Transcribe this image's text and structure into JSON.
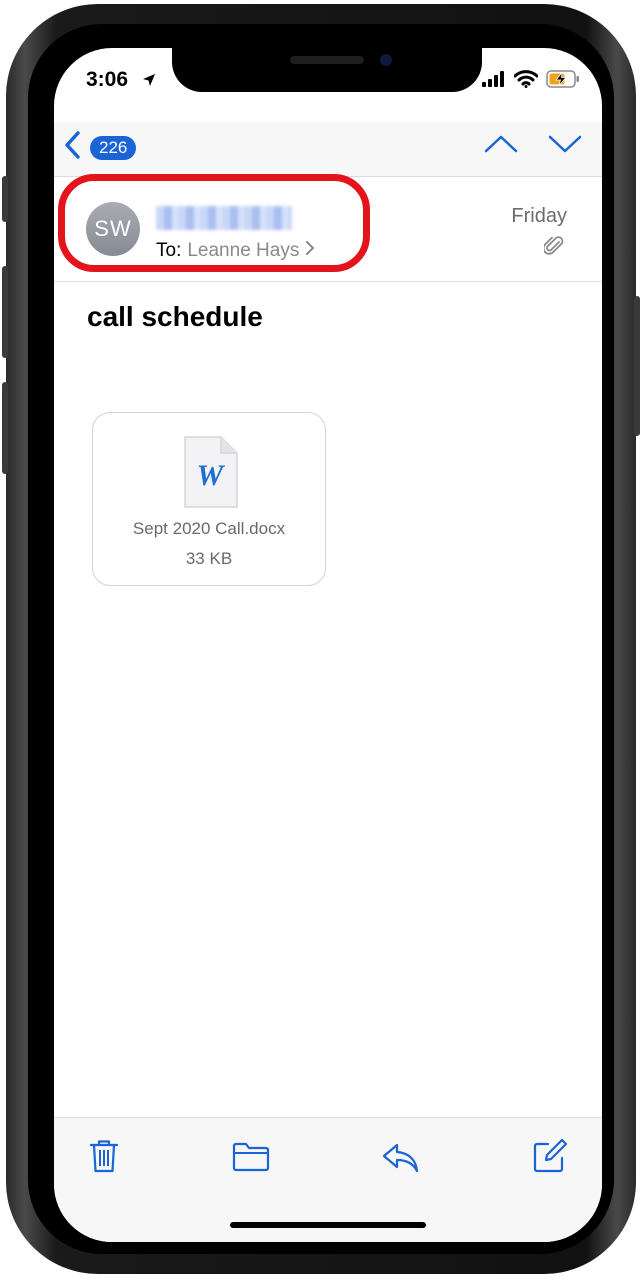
{
  "status_bar": {
    "time": "3:06"
  },
  "nav": {
    "message_count": "226"
  },
  "header": {
    "sender_initials": "SW",
    "sender_name": "",
    "to_label": "To:",
    "recipient": "Leanne Hays",
    "date": "Friday"
  },
  "message": {
    "subject": "call schedule"
  },
  "attachment": {
    "file_name": "Sept 2020 Call.docx",
    "file_size": "33 KB",
    "icon_letter": "W"
  },
  "icons": {
    "back": "chevron-left-icon",
    "up": "chevron-up-icon",
    "down": "chevron-down-icon",
    "paperclip": "paperclip-icon",
    "trash": "trash-icon",
    "folder": "folder-icon",
    "reply": "reply-icon",
    "compose": "compose-icon"
  },
  "colors": {
    "accent": "#1a64d6",
    "highlight": "#e3141b",
    "badge": "#1a64d6"
  }
}
